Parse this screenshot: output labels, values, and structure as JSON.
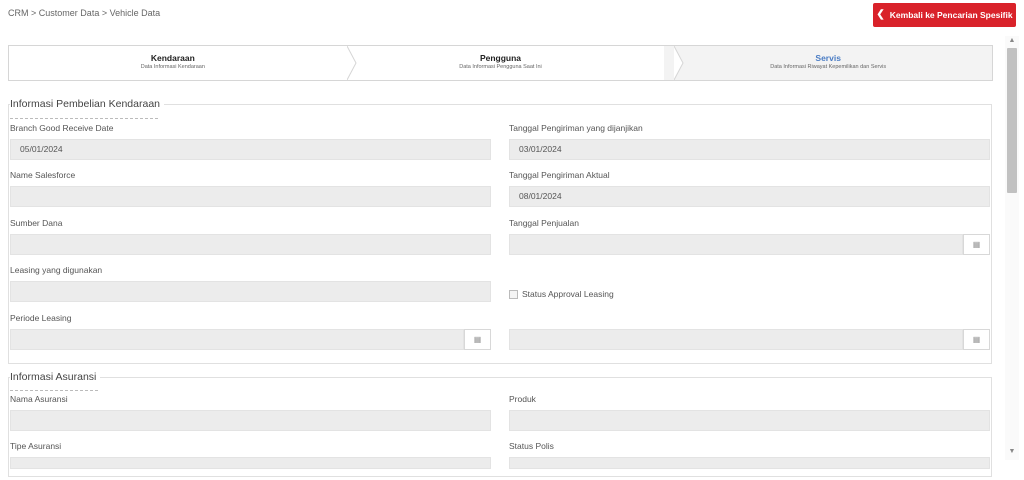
{
  "breadcrumb": {
    "items": [
      "CRM",
      "Customer Data",
      "Vehicle Data"
    ],
    "separator": ">"
  },
  "back_button": {
    "icon": "chevron-left-icon",
    "label": "Kembali ke Pencarian Spesifik",
    "color": "#d9222a"
  },
  "wizard": {
    "steps": [
      {
        "title": "Kendaraan",
        "subtitle": "Data Informasi Kendaraan",
        "active": false
      },
      {
        "title": "Pengguna",
        "subtitle": "Data Informasi Pengguna Saat Ini",
        "active": false
      },
      {
        "title": "Servis",
        "subtitle": "Data Informasi Riwayat Kepemilikan dan Servis",
        "active": true
      }
    ],
    "active_color": "#4a7cc4"
  },
  "purchase_section": {
    "legend": "Informasi Pembelian Kendaraan",
    "fields": {
      "branch_good_receive_date": {
        "label": "Branch Good Receive Date",
        "value": "05/01/2024"
      },
      "tanggal_pengiriman_dijanjikan": {
        "label": "Tanggal Pengiriman yang dijanjikan",
        "value": "03/01/2024"
      },
      "name_salesforce": {
        "label": "Name Salesforce",
        "value": ""
      },
      "tanggal_pengiriman_aktual": {
        "label": "Tanggal Pengiriman Aktual",
        "value": "08/01/2024"
      },
      "sumber_dana": {
        "label": "Sumber Dana",
        "value": ""
      },
      "tanggal_penjualan": {
        "label": "Tanggal Penjualan",
        "value": ""
      },
      "leasing_digunakan": {
        "label": "Leasing yang digunakan",
        "value": ""
      },
      "status_approval_leasing": {
        "label": "Status Approval Leasing",
        "checked": false
      },
      "periode_leasing": {
        "label": "Periode Leasing",
        "value": ""
      },
      "periode_leasing_end": {
        "value": ""
      }
    }
  },
  "insurance_section": {
    "legend": "Informasi Asuransi",
    "fields": {
      "nama_asuransi": {
        "label": "Nama Asuransi",
        "value": ""
      },
      "produk": {
        "label": "Produk",
        "value": ""
      },
      "tipe_asuransi": {
        "label": "Tipe Asuransi",
        "value": ""
      },
      "status_polis": {
        "label": "Status Polis",
        "value": ""
      }
    }
  },
  "icons": {
    "calendar": "calendar-icon",
    "scroll_up": "scroll-up-icon",
    "scroll_down": "scroll-down-icon"
  }
}
